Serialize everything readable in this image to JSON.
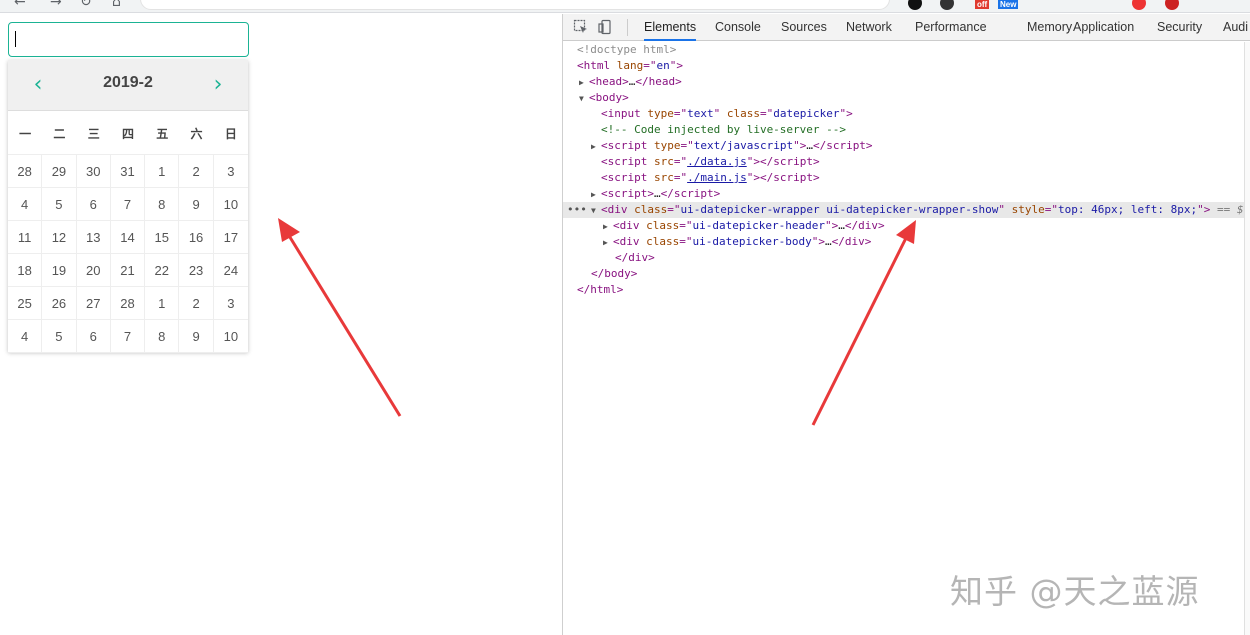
{
  "datepicker": {
    "title": "2019-2",
    "prev_icon": "‹",
    "next_icon": "›",
    "weekdays": [
      "一",
      "二",
      "三",
      "四",
      "五",
      "六",
      "日"
    ],
    "days": [
      [
        "28",
        "29",
        "30",
        "31",
        "1",
        "2",
        "3"
      ],
      [
        "4",
        "5",
        "6",
        "7",
        "8",
        "9",
        "10"
      ],
      [
        "11",
        "12",
        "13",
        "14",
        "15",
        "16",
        "17"
      ],
      [
        "18",
        "19",
        "20",
        "21",
        "22",
        "23",
        "24"
      ],
      [
        "25",
        "26",
        "27",
        "28",
        "1",
        "2",
        "3"
      ],
      [
        "4",
        "5",
        "6",
        "7",
        "8",
        "9",
        "10"
      ]
    ]
  },
  "extensions": {
    "badge_off": "off",
    "badge_new": "New"
  },
  "devtools": {
    "tabs": [
      "Elements",
      "Console",
      "Sources",
      "Network",
      "Performance",
      "Memory",
      "Application",
      "Security",
      "Audi"
    ],
    "active_tab": "Elements",
    "dom": {
      "doctype": "<!doctype html>",
      "html_open_tag": "html",
      "html_attr": "lang",
      "html_attr_val": "en",
      "head_collapsed": "…",
      "input_type": "text",
      "input_class": "datepicker",
      "comment": "<!-- Code injected by live-server -->",
      "script_type": "text/javascript",
      "script_src_1": "./data.js",
      "script_src_2": "./main.js",
      "div_class": "ui-datepicker-wrapper ui-datepicker-wrapper-show",
      "div_style": "top: 46px; left: 8px;",
      "eq": "== $0",
      "header_class": "ui-datepicker-header",
      "body_class": "ui-datepicker-body"
    }
  },
  "watermark": "知乎 @天之蓝源",
  "colors": {
    "accent": "#1bb394",
    "arrow": "#e8393a",
    "tab_active": "#1a73e8"
  }
}
